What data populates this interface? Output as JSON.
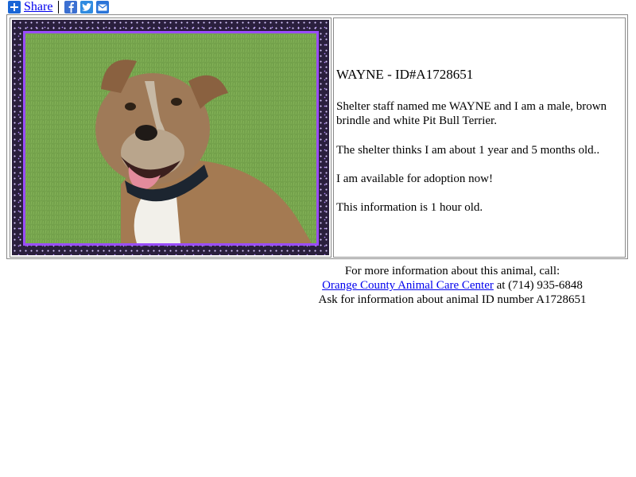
{
  "share_bar": {
    "share_label": "Share",
    "icons": [
      "plus-icon",
      "facebook-icon",
      "twitter-icon",
      "email-icon"
    ]
  },
  "animal": {
    "heading": "WAYNE - ID#A1728651",
    "description_1": "Shelter staff named me WAYNE and I am a male, brown brindle and white Pit Bull Terrier.",
    "description_2": "The shelter thinks I am about 1 year and 5 months old..",
    "description_3": "I am available for adoption now!",
    "description_4": "This information is 1 hour old."
  },
  "footer": {
    "line1": "For more information about this animal, call:",
    "shelter_link": "Orange County Animal Care Center",
    "phone_text": " at (714) 935-6848",
    "line3": "Ask for information about animal ID number A1728651"
  },
  "colors": {
    "link": "#0000ee",
    "frame_border": "#9a4dff",
    "frame_bg": "#2a1f3d"
  }
}
